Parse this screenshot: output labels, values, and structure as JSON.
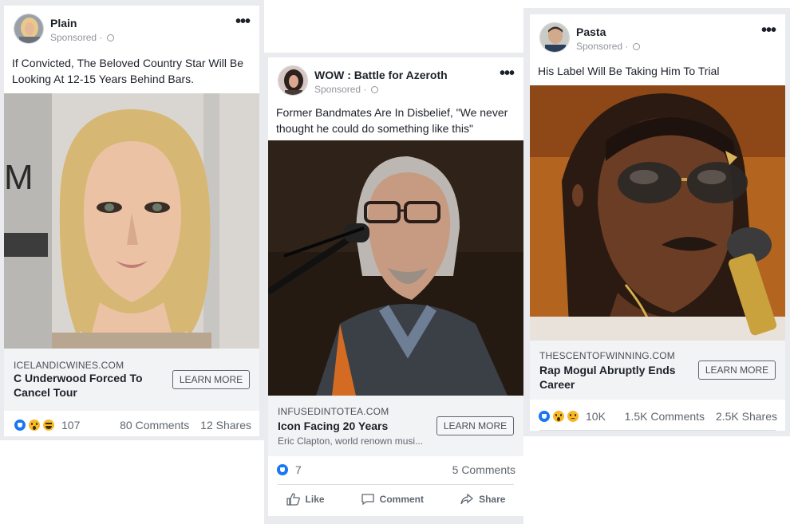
{
  "ads": [
    {
      "page_name": "Plain",
      "sponsored": "Sponsored ·",
      "text": "If Convicted, The Beloved Country Star Will Be Looking At 12-15 Years Behind Bars.",
      "domain": "ICELANDICWINES.COM",
      "headline": "C Underwood Forced To Cancel Tour",
      "cta": "LEARN MORE",
      "reactions": [
        "like",
        "wow",
        "haha"
      ],
      "reaction_count": "107",
      "comments": "80 Comments",
      "shares": "12 Shares"
    },
    {
      "page_name": "WOW : Battle for Azeroth",
      "sponsored": "Sponsored ·",
      "text": "Former Bandmates Are In Disbelief, \"We never thought he could do something like this\"",
      "domain": "INFUSEDINTOTEA.COM",
      "headline": "Icon Facing 20 Years",
      "description": "Eric Clapton, world renown musi...",
      "cta": "LEARN MORE",
      "reactions": [
        "like"
      ],
      "reaction_count": "7",
      "comments": "5 Comments",
      "actions": {
        "like": "Like",
        "comment": "Comment",
        "share": "Share"
      }
    },
    {
      "page_name": "Pasta",
      "sponsored": "Sponsored ·",
      "text": "His Label Will Be Taking Him To Trial",
      "domain": "THESCENTOFWINNING.COM",
      "headline": "Rap Mogul Abruptly Ends Career",
      "cta": "LEARN MORE",
      "reactions": [
        "like",
        "wow",
        "sad"
      ],
      "reaction_count": "10K",
      "comments": "1.5K Comments",
      "shares": "2.5K Shares"
    }
  ],
  "icons": {
    "more": "more-options-icon",
    "globe": "globe-icon",
    "like_reaction": "like-reaction-icon",
    "wow_reaction": "wow-reaction-icon",
    "haha_reaction": "haha-reaction-icon",
    "sad_reaction": "sad-reaction-icon"
  },
  "colors": {
    "facebook_blue": "#1877f2",
    "link_box_bg": "#f2f3f5",
    "feed_bg": "#e9ebee"
  }
}
